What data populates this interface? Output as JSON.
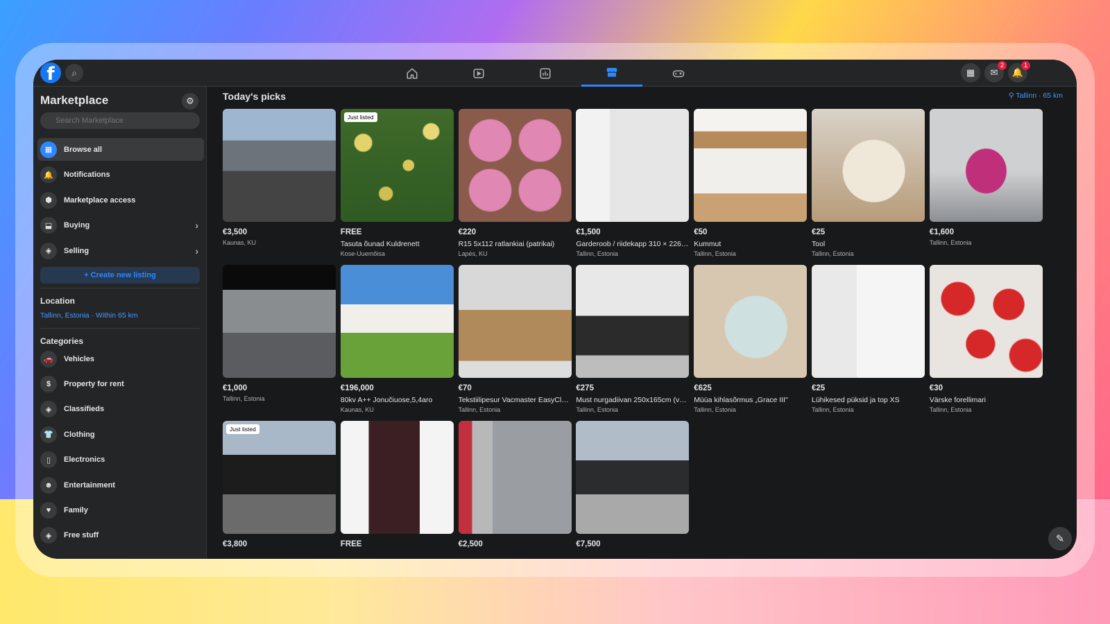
{
  "sidebar": {
    "title": "Marketplace",
    "search_placeholder": "Search Marketplace",
    "items": [
      {
        "label": "Browse all",
        "icon": "storefront-icon",
        "glyph": "▦"
      },
      {
        "label": "Notifications",
        "icon": "bell-icon",
        "glyph": "🔔"
      },
      {
        "label": "Marketplace access",
        "icon": "shield-icon",
        "glyph": "⬢"
      },
      {
        "label": "Buying",
        "icon": "bag-icon",
        "glyph": "⬓"
      },
      {
        "label": "Selling",
        "icon": "tag-icon",
        "glyph": "◈"
      }
    ],
    "create_label": "+ Create new listing",
    "location_heading": "Location",
    "location_value": "Tallinn, Estonia · Within 65 km",
    "categories_heading": "Categories",
    "categories": [
      {
        "label": "Vehicles",
        "icon": "car-icon",
        "glyph": "🚗"
      },
      {
        "label": "Property for rent",
        "icon": "house-money-icon",
        "glyph": "$"
      },
      {
        "label": "Classifieds",
        "icon": "tag-icon",
        "glyph": "◈"
      },
      {
        "label": "Clothing",
        "icon": "shirt-icon",
        "glyph": "👕"
      },
      {
        "label": "Electronics",
        "icon": "phone-icon",
        "glyph": "▯"
      },
      {
        "label": "Entertainment",
        "icon": "people-icon",
        "glyph": "☻"
      },
      {
        "label": "Family",
        "icon": "heart-icon",
        "glyph": "♥"
      },
      {
        "label": "Free stuff",
        "icon": "tag-icon",
        "glyph": "◈"
      }
    ]
  },
  "top": {
    "messenger_badge": "2",
    "notifications_badge": "1"
  },
  "main": {
    "title": "Today's picks",
    "location_link": "Tallinn · 65 km",
    "just_listed_label": "Just listed",
    "listings": [
      {
        "price": "€3,500",
        "title": "",
        "location": "Kaunas, KU",
        "just_listed": false,
        "paint": "p-car-blue"
      },
      {
        "price": "FREE",
        "title": "Tasuta õunad Kuldrenett",
        "location": "Kose-Uuemõisa",
        "just_listed": true,
        "paint": "p-apples"
      },
      {
        "price": "€220",
        "title": "R15 5x112 ratlankiai (patrikai)",
        "location": "Lapės, KU",
        "just_listed": false,
        "paint": "p-rims"
      },
      {
        "price": "€1,500",
        "title": "Garderoob / riidekapp 310 × 226 ...",
        "location": "Tallinn, Estonia",
        "just_listed": false,
        "paint": "p-wardrobe"
      },
      {
        "price": "€50",
        "title": "Kummut",
        "location": "Tallinn, Estonia",
        "just_listed": false,
        "paint": "p-dresser"
      },
      {
        "price": "€25",
        "title": "Tool",
        "location": "Tallinn, Estonia",
        "just_listed": false,
        "paint": "p-chair"
      },
      {
        "price": "€1,600",
        "title": "",
        "location": "Tallinn, Estonia",
        "just_listed": false,
        "paint": "p-moto"
      },
      {
        "price": "€1,000",
        "title": "",
        "location": "Tallinn, Estonia",
        "just_listed": false,
        "paint": "p-audi"
      },
      {
        "price": "€196,000",
        "title": "80kv A++ Jonučiuose,5,4aro",
        "location": "Kaunas, KU",
        "just_listed": false,
        "paint": "p-house"
      },
      {
        "price": "€70",
        "title": "Tekstiilipesur Vacmaster EasyClea...",
        "location": "Tallinn, Estonia",
        "just_listed": false,
        "paint": "p-cleaner"
      },
      {
        "price": "€275",
        "title": "Must nurgadiivan 250x165cm (va...",
        "location": "Tallinn, Estonia",
        "just_listed": false,
        "paint": "p-sofa"
      },
      {
        "price": "€625",
        "title": "Müüa kihlasõrmus „Grace III\"",
        "location": "Tallinn, Estonia",
        "just_listed": false,
        "paint": "p-ring"
      },
      {
        "price": "€25",
        "title": "Lühikesed püksid ja top XS",
        "location": "Tallinn, Estonia",
        "just_listed": false,
        "paint": "p-room"
      },
      {
        "price": "€30",
        "title": "Värske forellimari",
        "location": "Tallinn, Estonia",
        "just_listed": false,
        "paint": "p-fish"
      },
      {
        "price": "€3,800",
        "title": "",
        "location": "",
        "just_listed": true,
        "paint": "p-bmw"
      },
      {
        "price": "FREE",
        "title": "",
        "location": "",
        "just_listed": false,
        "paint": "p-drawers"
      },
      {
        "price": "€2,500",
        "title": "",
        "location": "",
        "just_listed": false,
        "paint": "p-skoda-silver"
      },
      {
        "price": "€7,500",
        "title": "",
        "location": "",
        "just_listed": false,
        "paint": "p-skoda-black"
      }
    ]
  },
  "colors": {
    "accent": "#2d88ff",
    "app_bg": "#18191a",
    "panel_bg": "#242526"
  }
}
